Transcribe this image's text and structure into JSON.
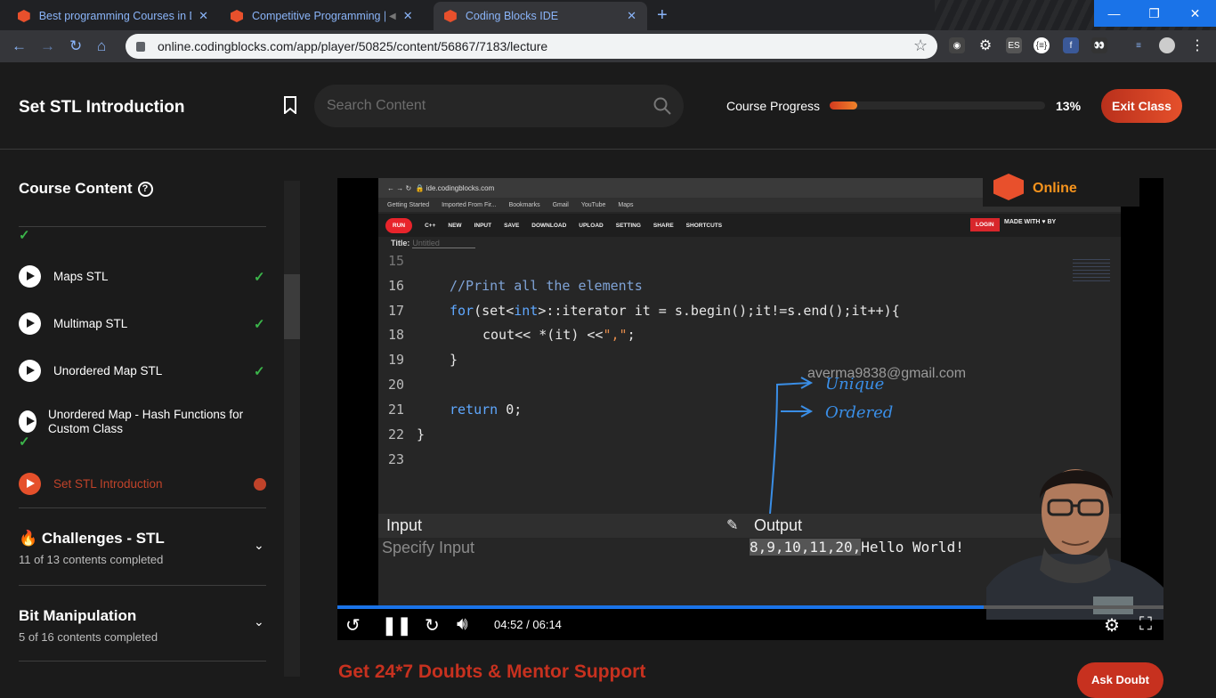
{
  "browser": {
    "tabs": [
      {
        "title": "Best programming Courses in De",
        "active": false
      },
      {
        "title": "Competitive Programming |",
        "active": false
      },
      {
        "title": "Coding Blocks IDE",
        "active": true
      }
    ],
    "url": "online.codingblocks.com/app/player/50825/content/56867/7183/lecture"
  },
  "header": {
    "title": "Set STL Introduction",
    "search_placeholder": "Search Content",
    "progress_label": "Course Progress",
    "progress_value": 13,
    "progress_text": "13%",
    "exit_label": "Exit Class"
  },
  "sidebar": {
    "title": "Course Content",
    "lessons": [
      {
        "label": "Maps STL",
        "done": true
      },
      {
        "label": "Multimap STL",
        "done": true
      },
      {
        "label": "Unordered Map STL",
        "done": true
      },
      {
        "label": "Unordered Map - Hash Functions for Custom Class",
        "done": true
      },
      {
        "label": "Set STL Introduction",
        "done": false,
        "current": true
      }
    ],
    "sections": [
      {
        "title": "Challenges - STL",
        "subtitle": "11 of 13 contents completed",
        "emoji": "🔥"
      },
      {
        "title": "Bit Manipulation",
        "subtitle": "5 of 16 contents completed"
      }
    ]
  },
  "video": {
    "ide_url": "ide.codingblocks.com",
    "bookmarks": [
      "Getting Started",
      "Imported From Fir...",
      "Bookmarks",
      "Gmail",
      "YouTube",
      "Maps"
    ],
    "menu": [
      "RUN",
      "C++",
      "NEW",
      "INPUT",
      "SAVE",
      "DOWNLOAD",
      "UPLOAD",
      "SETTING",
      "SHARE",
      "SHORTCUTS"
    ],
    "login": "LOGIN",
    "made_with": "MADE WITH ♥ BY",
    "title_label": "Title:",
    "title_placeholder": "Untitled",
    "line_numbers": [
      "15",
      "16",
      "17",
      "18",
      "19",
      "20",
      "21",
      "22",
      "23"
    ],
    "code": {
      "l16": "//Print all the elements",
      "l17a": "for",
      "l17b": "(set<",
      "l17c": "int",
      "l17d": ">::iterator it = s.begin();it!=s.end();it++){",
      "l18a": "cout<< *(it) <<",
      "l18b": "\",\"",
      "l18c": ";",
      "l19": "}",
      "l21a": "return",
      "l21b": " 0;",
      "l22": "}"
    },
    "input_label": "Input",
    "output_label": "Output",
    "input_placeholder": "Specify Input",
    "output_highlight": "8,9,10,11,20,",
    "output_rest": "Hello World!",
    "watermark_email": "averma9838@gmail.com",
    "annotation_1": "Unique",
    "annotation_2": "Ordered",
    "logo_text": "Online",
    "time": "04:52 / 06:14",
    "progress_fraction": 0.782
  },
  "bottom": {
    "banner": "Get 24*7 Doubts & Mentor Support",
    "ask_label": "Ask Doubt"
  }
}
